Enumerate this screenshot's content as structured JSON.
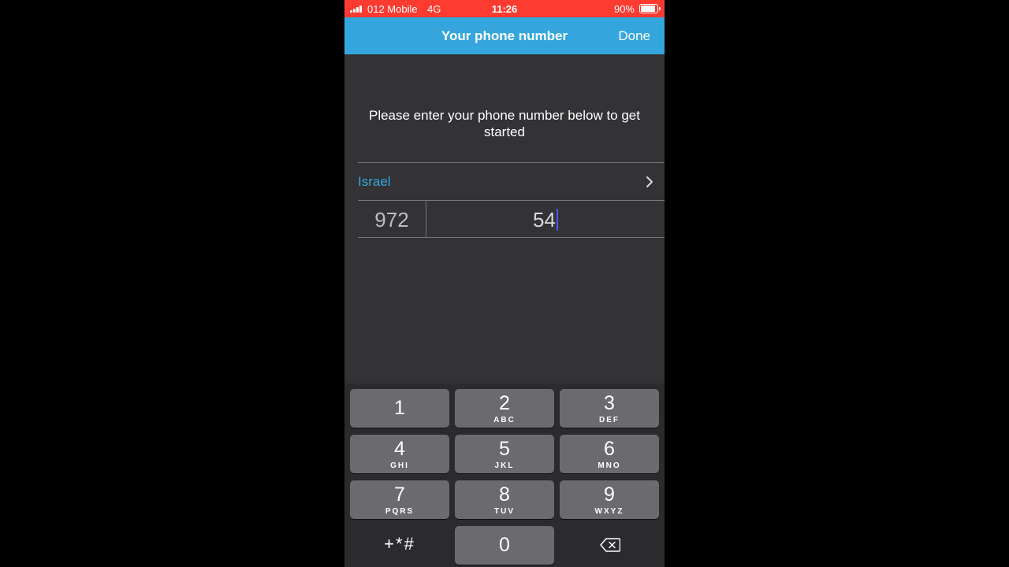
{
  "status_bar": {
    "carrier": "012 Mobile",
    "network": "4G",
    "time": "11:26",
    "battery": "90%",
    "battery_level": 0.9
  },
  "nav": {
    "title": "Your phone number",
    "done_label": "Done"
  },
  "form": {
    "instruction": "Please enter your phone number below to get started",
    "country": "Israel",
    "country_code": "972",
    "phone_value": "54"
  },
  "keypad": {
    "keys": [
      {
        "digit": "1",
        "letters": ""
      },
      {
        "digit": "2",
        "letters": "ABC"
      },
      {
        "digit": "3",
        "letters": "DEF"
      },
      {
        "digit": "4",
        "letters": "GHI"
      },
      {
        "digit": "5",
        "letters": "JKL"
      },
      {
        "digit": "6",
        "letters": "MNO"
      },
      {
        "digit": "7",
        "letters": "PQRS"
      },
      {
        "digit": "8",
        "letters": "TUV"
      },
      {
        "digit": "9",
        "letters": "WXYZ"
      },
      {
        "digit": "0",
        "letters": ""
      }
    ],
    "symbols": "+*#",
    "backspace_icon": "backspace-icon"
  },
  "colors": {
    "status_bar": "#fe3b30",
    "nav_bar": "#34a6dd",
    "accent": "#34a6dd",
    "background": "#333234",
    "caret": "#3f5cff"
  }
}
